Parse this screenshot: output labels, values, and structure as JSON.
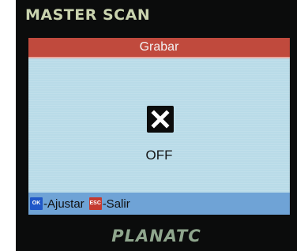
{
  "device": {
    "brand": "MASTER SCAN",
    "logo": "PLANATC"
  },
  "screen": {
    "title": "Grabar",
    "toggle": {
      "icon": "checkbox-x-icon",
      "state": "OFF"
    },
    "footer": {
      "ok_key": "OK",
      "ok_label": "-Ajustar",
      "esc_key": "ESC",
      "esc_label": "-Salir"
    }
  },
  "colors": {
    "title_bar": "#c04a3d",
    "screen_bg": "#b9dbe8",
    "footer_bg": "#6fa3d6",
    "ok_key": "#1f57c8",
    "esc_key": "#c53a2f"
  }
}
